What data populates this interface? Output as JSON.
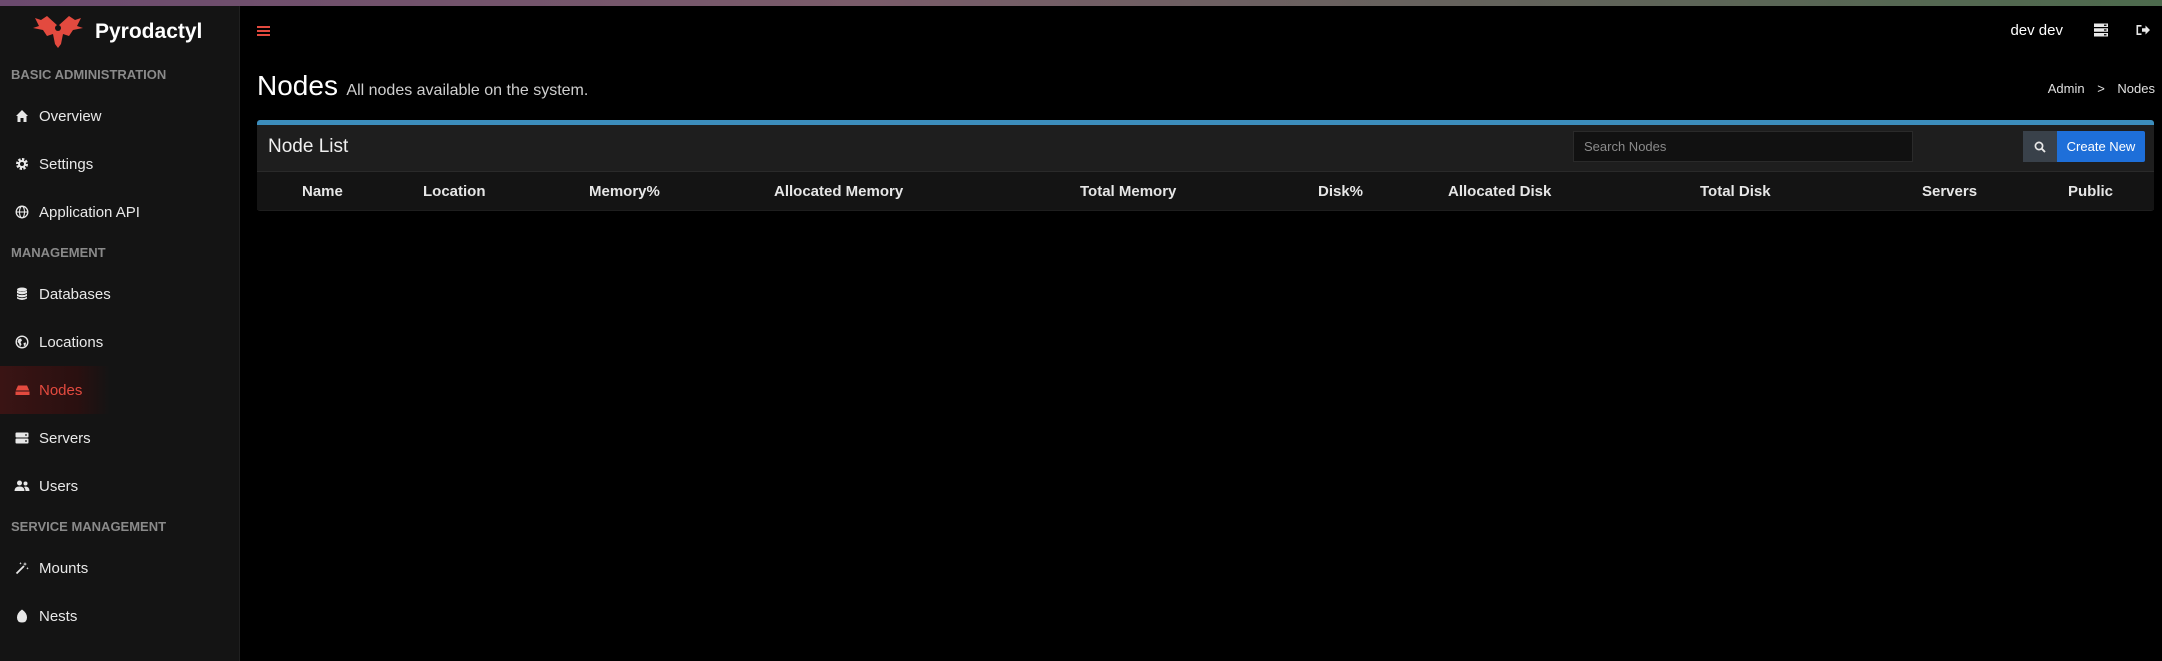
{
  "brand": {
    "name": "Pyrodactyl",
    "accent": "#e34a3f"
  },
  "sidebar": {
    "sections": [
      {
        "header": "BASIC ADMINISTRATION",
        "items": [
          {
            "label": "Overview",
            "icon": "home-icon"
          },
          {
            "label": "Settings",
            "icon": "gear-icon"
          },
          {
            "label": "Application API",
            "icon": "globe-icon"
          }
        ]
      },
      {
        "header": "MANAGEMENT",
        "items": [
          {
            "label": "Databases",
            "icon": "database-icon"
          },
          {
            "label": "Locations",
            "icon": "globe-americas-icon"
          },
          {
            "label": "Nodes",
            "icon": "nodes-icon",
            "active": true
          },
          {
            "label": "Servers",
            "icon": "server-icon"
          },
          {
            "label": "Users",
            "icon": "users-icon"
          }
        ]
      },
      {
        "header": "SERVICE MANAGEMENT",
        "items": [
          {
            "label": "Mounts",
            "icon": "magic-icon"
          },
          {
            "label": "Nests",
            "icon": "egg-icon"
          }
        ]
      }
    ]
  },
  "topbar": {
    "user": "dev dev"
  },
  "page": {
    "title": "Nodes",
    "subtitle": "All nodes available on the system."
  },
  "breadcrumb": {
    "root": "Admin",
    "separator": ">",
    "current": "Nodes"
  },
  "panel": {
    "title": "Node List",
    "search_placeholder": "Search Nodes",
    "create_label": "Create New",
    "border_color": "#3c8dbc",
    "button_color": "#1e6fd9",
    "columns": [
      "Name",
      "Location",
      "Memory%",
      "Allocated Memory",
      "Total Memory",
      "Disk%",
      "Allocated Disk",
      "Total Disk",
      "Servers",
      "Public"
    ]
  }
}
